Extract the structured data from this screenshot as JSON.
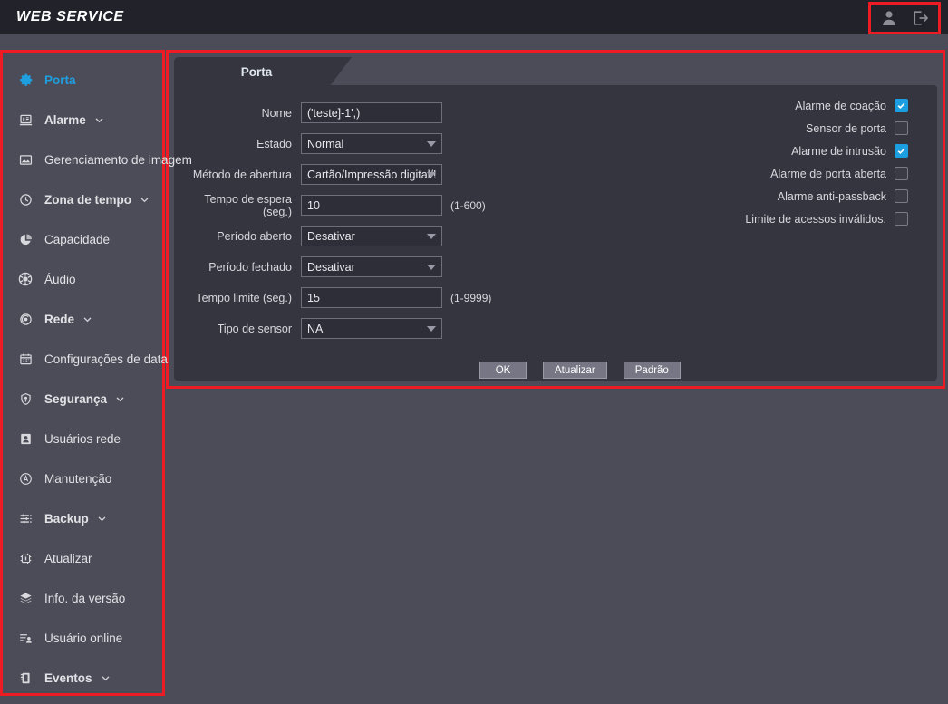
{
  "topbar": {
    "brand": "WEB SERVICE",
    "user_icon": "user-icon",
    "logout_icon": "logout-icon"
  },
  "sidebar": {
    "items": [
      {
        "label": "Porta",
        "icon": "gear-icon",
        "active": true,
        "chevron": false
      },
      {
        "label": "Alarme",
        "icon": "alarm-panel-icon",
        "active": false,
        "chevron": true
      },
      {
        "label": "Gerenciamento de imagem",
        "icon": "image-icon",
        "active": false,
        "chevron": false
      },
      {
        "label": "Zona de tempo",
        "icon": "clock-icon",
        "active": false,
        "chevron": true
      },
      {
        "label": "Capacidade",
        "icon": "pie-chart-icon",
        "active": false,
        "chevron": false
      },
      {
        "label": "Áudio",
        "icon": "audio-icon",
        "active": false,
        "chevron": false
      },
      {
        "label": "Rede",
        "icon": "network-icon",
        "active": false,
        "chevron": true
      },
      {
        "label": "Configurações de data",
        "icon": "calendar-icon",
        "active": false,
        "chevron": false
      },
      {
        "label": "Segurança",
        "icon": "shield-icon",
        "active": false,
        "chevron": true
      },
      {
        "label": "Usuários rede",
        "icon": "user-card-icon",
        "active": false,
        "chevron": false
      },
      {
        "label": "Manutenção",
        "icon": "maintenance-icon",
        "active": false,
        "chevron": false
      },
      {
        "label": "Backup",
        "icon": "sliders-icon",
        "active": false,
        "chevron": true
      },
      {
        "label": "Atualizar",
        "icon": "chip-icon",
        "active": false,
        "chevron": false
      },
      {
        "label": "Info. da versão",
        "icon": "layers-icon",
        "active": false,
        "chevron": false
      },
      {
        "label": "Usuário online",
        "icon": "online-user-icon",
        "active": false,
        "chevron": false
      },
      {
        "label": "Eventos",
        "icon": "notebook-icon",
        "active": false,
        "chevron": true
      }
    ]
  },
  "main": {
    "tab_label": "Porta",
    "fields": [
      {
        "label": "Nome",
        "type": "text",
        "value": "('teste]-1',)"
      },
      {
        "label": "Estado",
        "type": "select",
        "value": "Normal"
      },
      {
        "label": "Método de abertura",
        "type": "select",
        "value": "Cartão/Impressão digital/!"
      },
      {
        "label": "Tempo de espera (seg.)",
        "type": "text",
        "value": "10",
        "hint": "(1-600)"
      },
      {
        "label": "Período aberto",
        "type": "select",
        "value": "Desativar"
      },
      {
        "label": "Período fechado",
        "type": "select",
        "value": "Desativar"
      },
      {
        "label": "Tempo limite (seg.)",
        "type": "text",
        "value": "15",
        "hint": "(1-9999)"
      },
      {
        "label": "Tipo de sensor",
        "type": "select",
        "value": "NA"
      }
    ],
    "checkboxes": [
      {
        "label": "Alarme de coação",
        "checked": true
      },
      {
        "label": "Sensor de porta",
        "checked": false
      },
      {
        "label": "Alarme de intrusão",
        "checked": true
      },
      {
        "label": "Alarme de porta aberta",
        "checked": false
      },
      {
        "label": "Alarme anti-passback",
        "checked": false
      },
      {
        "label": "Limite de acessos inválidos.",
        "checked": false
      }
    ],
    "buttons": [
      {
        "label": "OK"
      },
      {
        "label": "Atualizar"
      },
      {
        "label": "Padrão"
      }
    ]
  },
  "colors": {
    "accent": "#1e9fe0",
    "annotation": "#ed1c24",
    "page_bg": "#4c4c58",
    "panel_bg": "#35353f",
    "topbar_bg": "#22222a"
  }
}
